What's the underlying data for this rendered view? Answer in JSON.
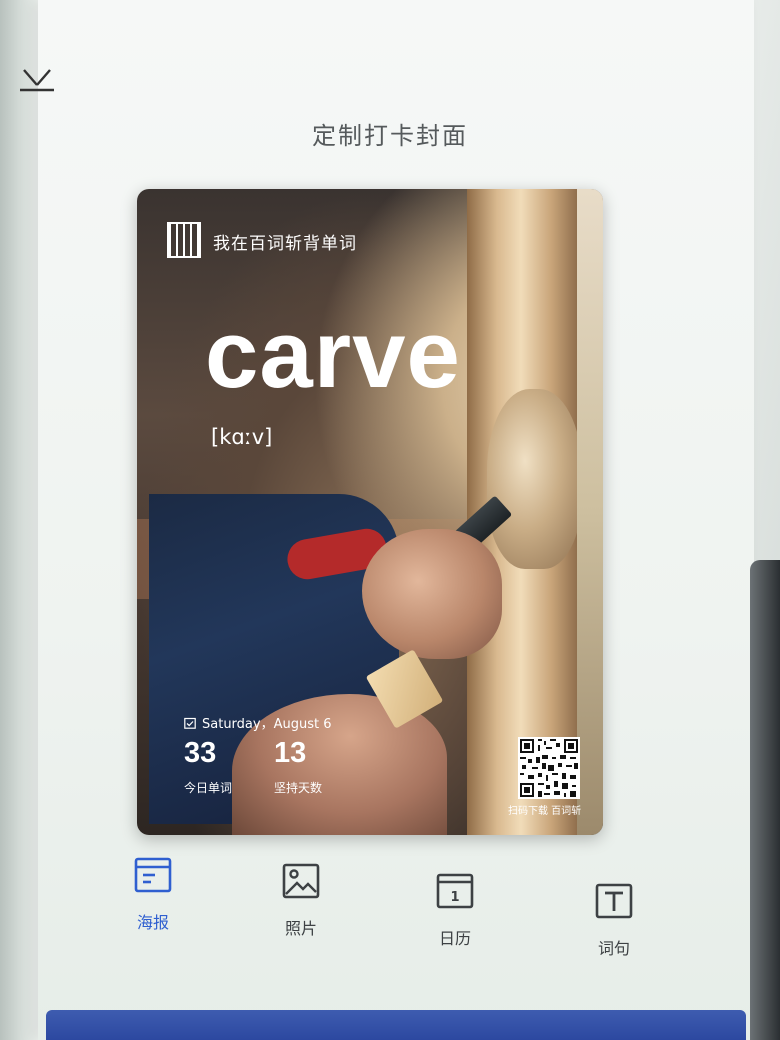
{
  "header": {
    "title": "定制打卡封面",
    "close_icon": "collapse-down-icon"
  },
  "poster": {
    "brand_text": "我在百词斩背单词",
    "word": "carve",
    "phonetic": "[kɑːv]",
    "date": "Saturday，August 6",
    "today_words": {
      "value": "33",
      "label": "今日单词"
    },
    "streak_days": {
      "value": "13",
      "label": "坚持天数"
    },
    "qr_caption": "扫码下载 百词斩"
  },
  "tabs": [
    {
      "label": "海报",
      "icon": "poster-icon",
      "active": true
    },
    {
      "label": "照片",
      "icon": "photo-icon",
      "active": false
    },
    {
      "label": "日历",
      "icon": "calendar-icon",
      "active": false
    },
    {
      "label": "词句",
      "icon": "text-icon",
      "active": false
    }
  ],
  "colors": {
    "accent": "#2f5fd0",
    "title_text": "#555a5c"
  }
}
